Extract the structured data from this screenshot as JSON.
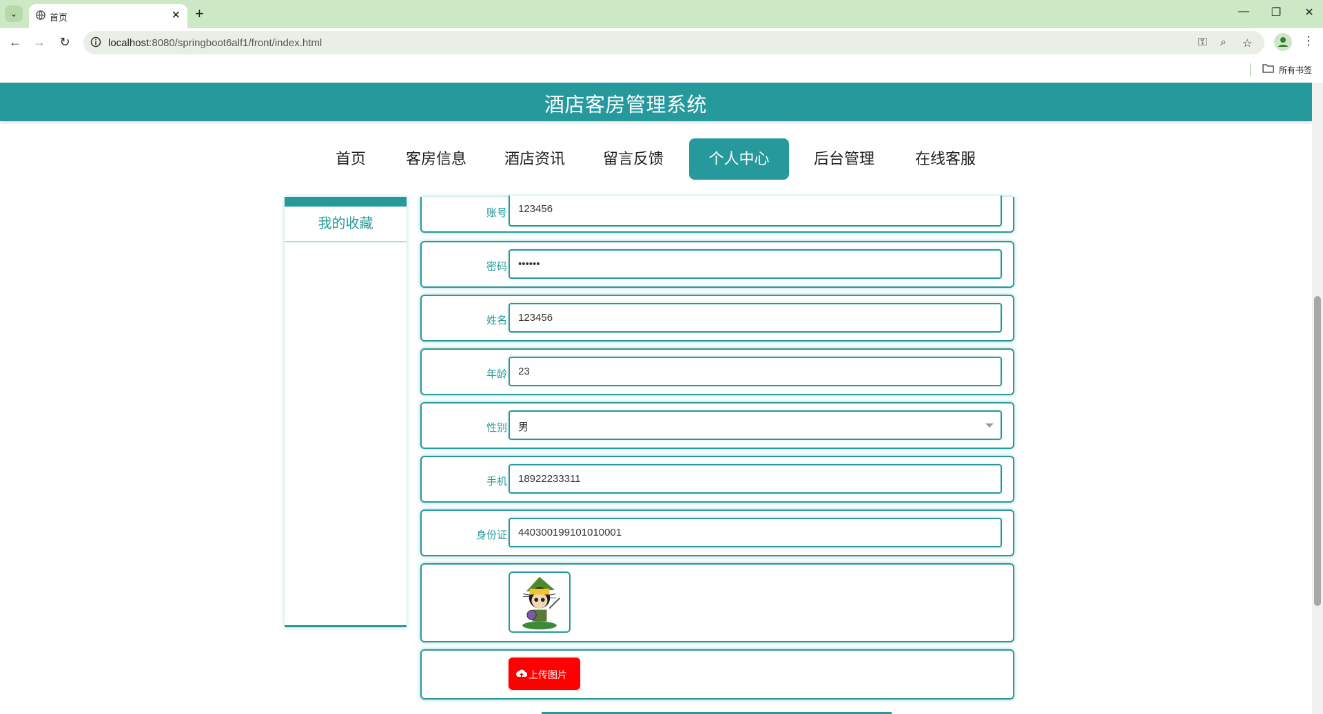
{
  "browser": {
    "tab_title": "首页",
    "url_host": "localhost",
    "url_rest": ":8080/springboot6alf1/front/index.html",
    "bookmarks_label": "所有书签"
  },
  "site": {
    "title": "酒店客房管理系统",
    "accent_color": "#26999c"
  },
  "nav": {
    "items": [
      "首页",
      "客房信息",
      "酒店资讯",
      "留言反馈",
      "个人中心",
      "后台管理",
      "在线客服"
    ],
    "active": "个人中心"
  },
  "sidebar": {
    "items": [
      "我的收藏"
    ]
  },
  "form": {
    "account_label": "账号",
    "account_value": "123456",
    "password_label": "密码",
    "password_value": "••••••",
    "name_label": "姓名",
    "name_value": "123456",
    "age_label": "年龄",
    "age_value": "23",
    "gender_label": "性别",
    "gender_value": "男",
    "phone_label": "手机",
    "phone_value": "18922233311",
    "idcard_label": "身份证",
    "idcard_value": "440300199101010001",
    "upload_label": "上传图片"
  }
}
